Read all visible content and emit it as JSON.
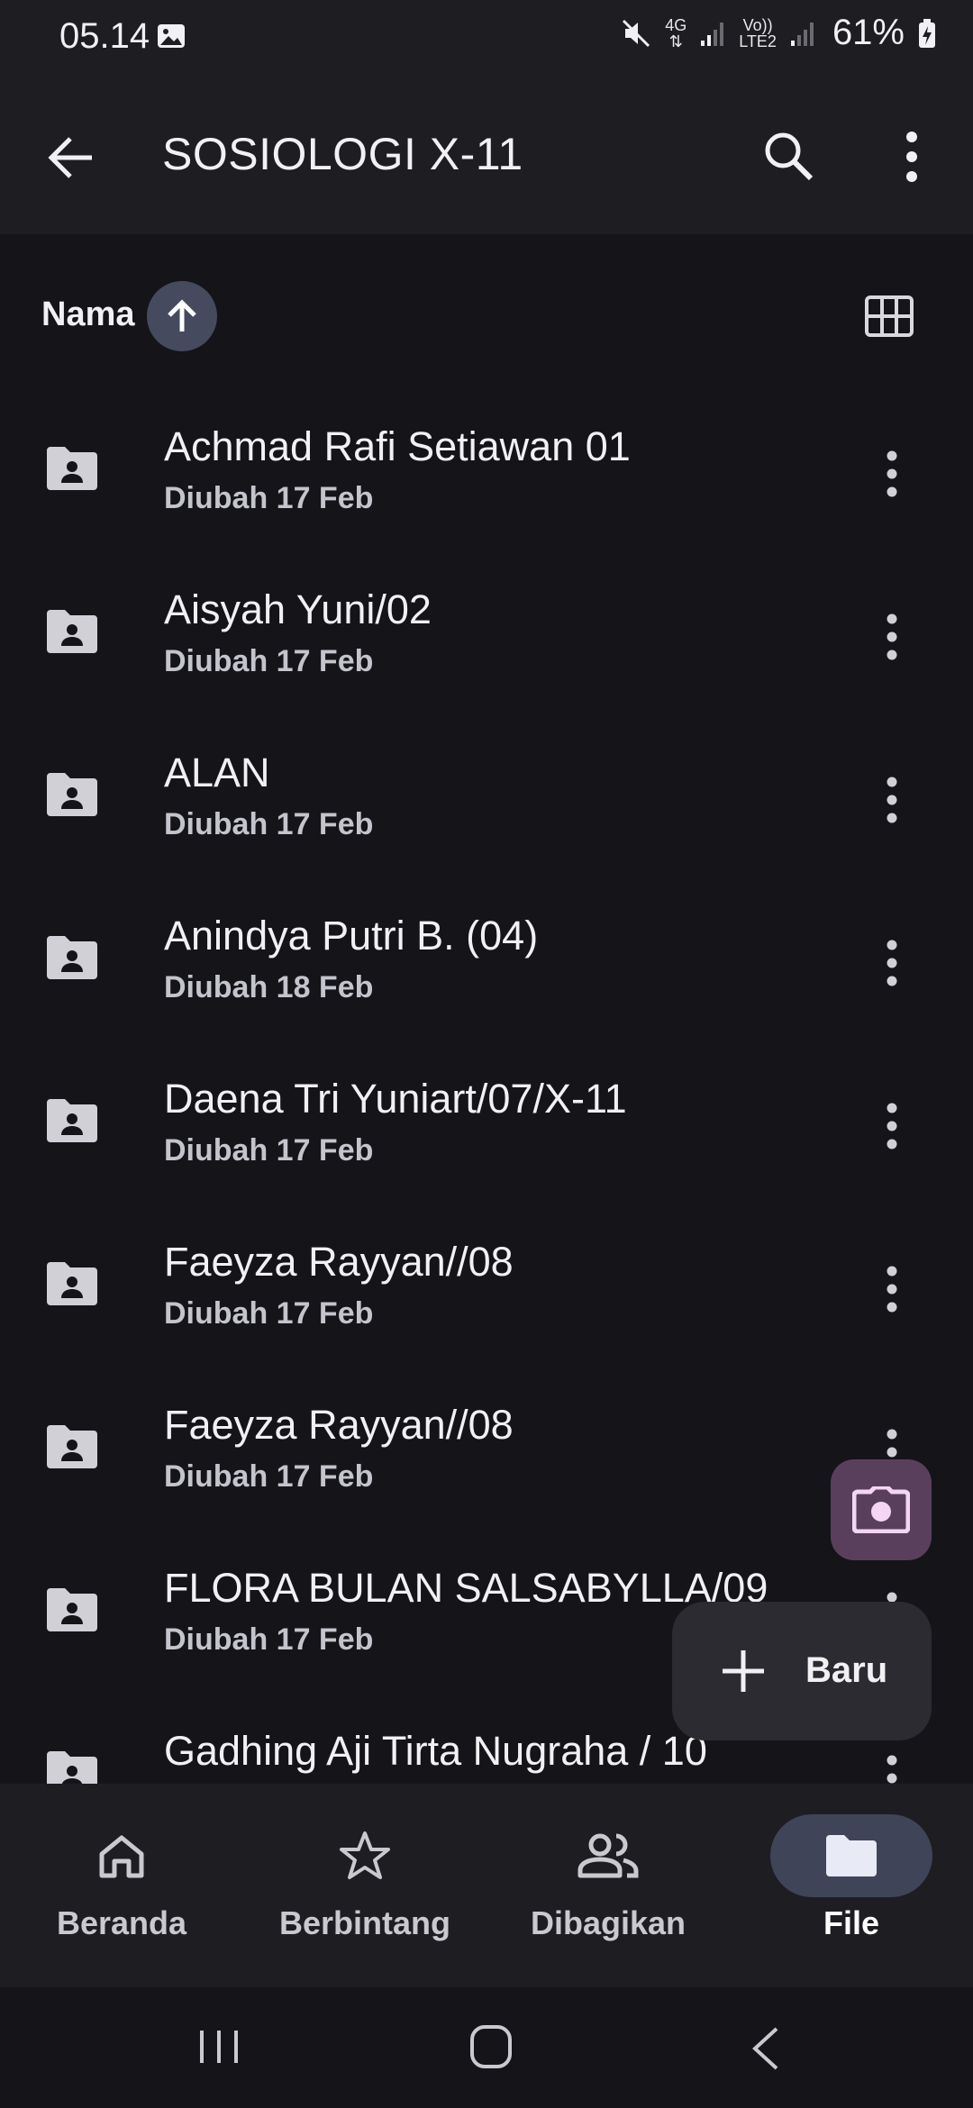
{
  "status_bar": {
    "time": "05.14",
    "network_4g": "4G",
    "volte_label": "Vo))",
    "lte_label": "LTE2",
    "battery": "61%"
  },
  "app_bar": {
    "title": "SOSIOLOGI X-11"
  },
  "sort": {
    "label": "Nama"
  },
  "files": [
    {
      "name": "Achmad Rafi Setiawan 01",
      "modified": "Diubah 17 Feb"
    },
    {
      "name": "Aisyah Yuni/02",
      "modified": "Diubah 17 Feb"
    },
    {
      "name": "ALAN",
      "modified": "Diubah 17 Feb"
    },
    {
      "name": "Anindya Putri B. (04)",
      "modified": "Diubah 18 Feb"
    },
    {
      "name": "Daena Tri Yuniart/07/X-11",
      "modified": "Diubah 17 Feb"
    },
    {
      "name": "Faeyza Rayyan//08",
      "modified": "Diubah 17 Feb"
    },
    {
      "name": "Faeyza Rayyan//08",
      "modified": "Diubah 17 Feb"
    },
    {
      "name": "FLORA BULAN SALSABYLLA/09",
      "modified": "Diubah 17 Feb"
    },
    {
      "name": "Gadhing Aji Tirta Nugraha / 10",
      "modified": ""
    }
  ],
  "fab": {
    "new_label": "Baru"
  },
  "bottom_nav": {
    "items": [
      {
        "label": "Beranda",
        "icon": "home-icon"
      },
      {
        "label": "Berbintang",
        "icon": "star-icon"
      },
      {
        "label": "Dibagikan",
        "icon": "people-icon"
      },
      {
        "label": "File",
        "icon": "folder-icon"
      }
    ],
    "active": "File"
  },
  "colors": {
    "background": "#141419",
    "surface": "#1d1d22",
    "sort_chip": "#454a5e",
    "camera_fab": "#5a3f5c",
    "nav_active": "#3f4459"
  }
}
